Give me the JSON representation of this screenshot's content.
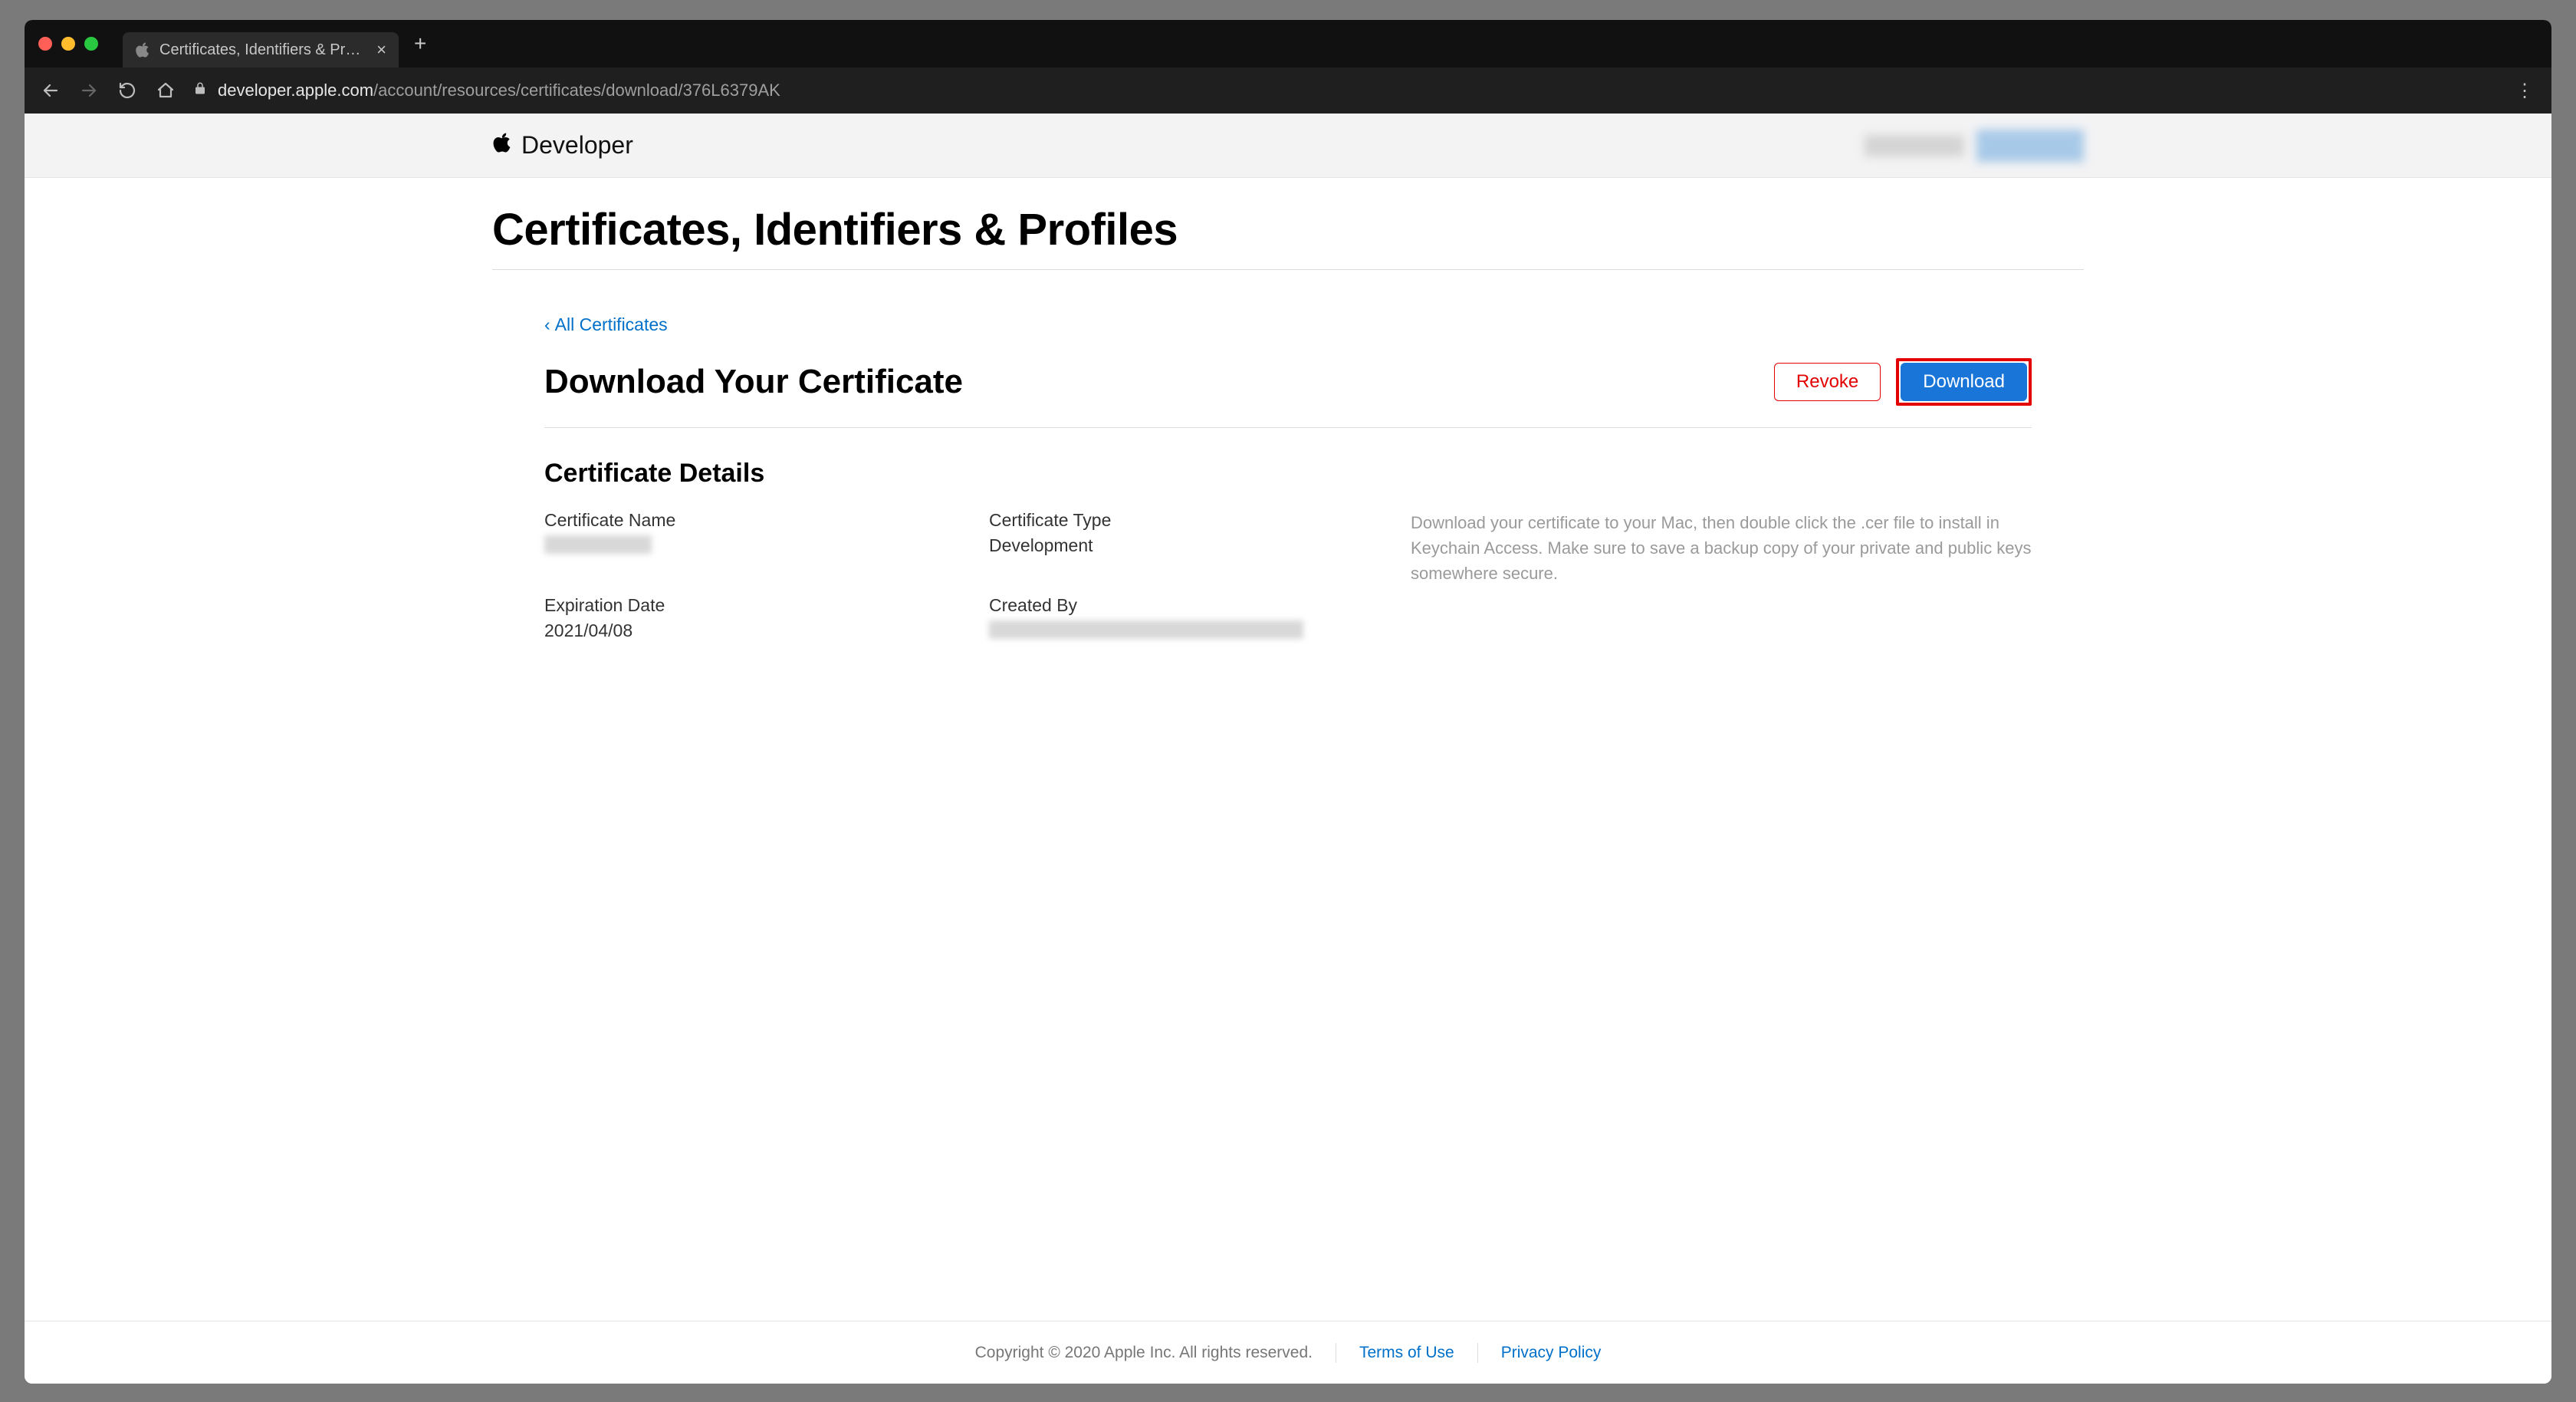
{
  "browser": {
    "tab_title": "Certificates, Identifiers & Profiles",
    "url_host": "developer.apple.com",
    "url_path": "/account/resources/certificates/download/376L6379AK"
  },
  "header": {
    "brand": "Developer"
  },
  "page": {
    "title": "Certificates, Identifiers & Profiles",
    "breadcrumb": "All Certificates",
    "sub_title": "Download Your Certificate",
    "buttons": {
      "revoke": "Revoke",
      "download": "Download"
    },
    "details_title": "Certificate Details",
    "fields": {
      "cert_name_label": "Certificate Name",
      "cert_type_label": "Certificate Type",
      "cert_type_value": "Development",
      "exp_label": "Expiration Date",
      "exp_value": "2021/04/08",
      "created_by_label": "Created By"
    },
    "help_text": "Download your certificate to your Mac, then double click the .cer file to install in Keychain Access. Make sure to save a backup copy of your private and public keys somewhere secure."
  },
  "footer": {
    "copyright": "Copyright © 2020 Apple Inc. All rights reserved.",
    "terms": "Terms of Use",
    "privacy": "Privacy Policy"
  }
}
